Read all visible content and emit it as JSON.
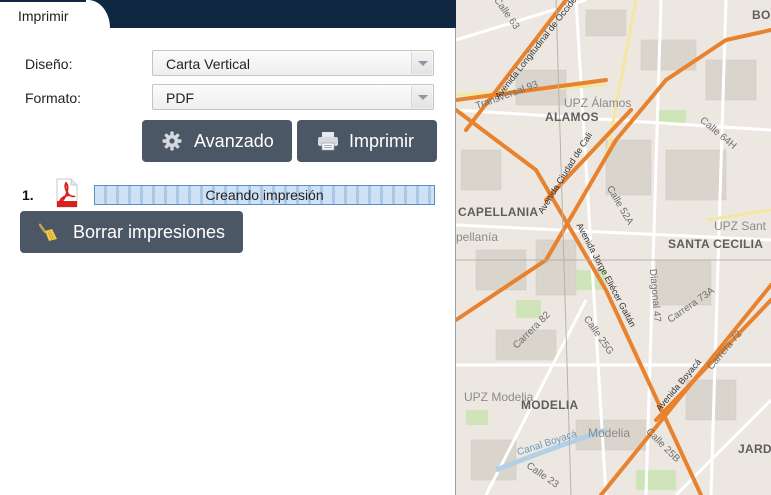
{
  "tab": {
    "label": "Imprimir"
  },
  "form": {
    "layout_label": "Diseño:",
    "layout_value": "Carta Vertical",
    "format_label": "Formato:",
    "format_value": "PDF"
  },
  "buttons": {
    "advanced_label": "Avanzado",
    "print_label": "Imprimir",
    "clear_label": "Borrar impresiones"
  },
  "job": {
    "index": "1.",
    "status": "Creando impresión"
  },
  "map": {
    "areas": [
      "ALAMOS",
      "CAPELLANIA",
      "SANTA CECILIA",
      "MODELIA",
      "BO",
      "JARD"
    ],
    "upz": [
      "UPZ Álamos",
      "UPZ Sant",
      "UPZ Modelia"
    ],
    "places": [
      "pellanía",
      "Modelia"
    ],
    "streets": [
      "Calle 63",
      "Calle 64H",
      "Calle 52A",
      "Carrera 73A",
      "Carrera 72",
      "Calle 25G",
      "Carrera 82",
      "Diagonal 47",
      "Calle 25B",
      "Calle 23",
      "Transversal 93",
      "Avenida Ciudad de Cali",
      "Avenida Jorge Eliécer Gaitán",
      "Avenida Longitudinal de Occidente",
      "Avenida Boyacá",
      "Canal Boyacá"
    ],
    "colors": {
      "avenue": "#e8822f",
      "park": "#cfe4b8",
      "water": "#b4d0e6",
      "background": "#ece8e1"
    }
  }
}
